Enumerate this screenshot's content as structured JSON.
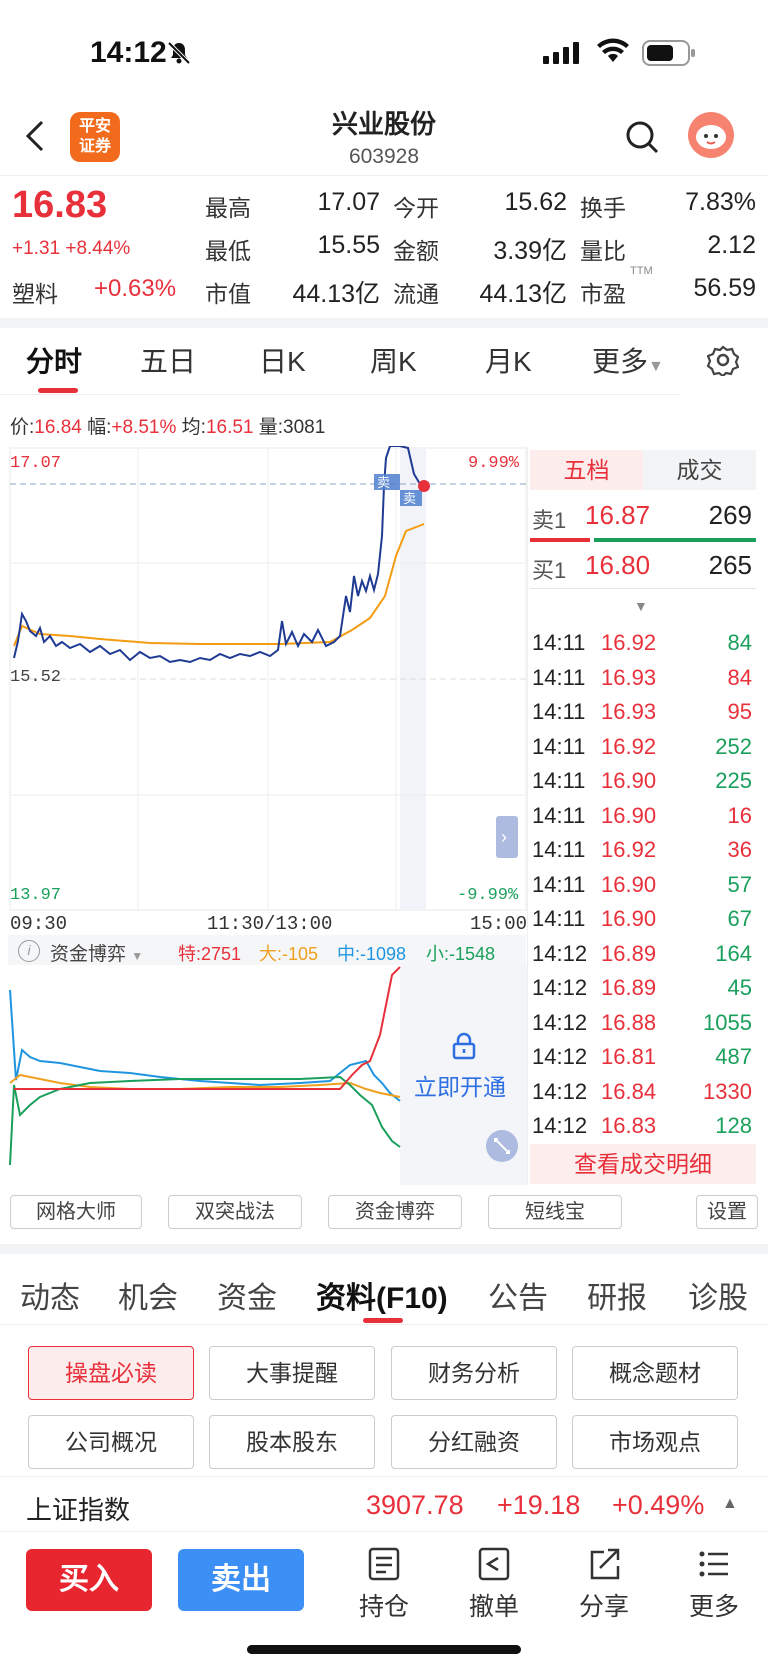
{
  "status": {
    "time": "14:12"
  },
  "header": {
    "brand": "平安\n证券",
    "name": "兴业股份",
    "code": "603928"
  },
  "quote": {
    "price": "16.83",
    "change": "+1.31",
    "change_pct": "+8.44%",
    "sector_name": "塑料",
    "sector_pct": "+0.63%",
    "high_label": "最高",
    "high": "17.07",
    "low_label": "最低",
    "low": "15.55",
    "mcap_label": "市值",
    "mcap": "44.13亿",
    "open_label": "今开",
    "open": "15.62",
    "amount_label": "金额",
    "amount": "3.39亿",
    "float_label": "流通",
    "float": "44.13亿",
    "turnover_label": "换手",
    "turnover": "7.83%",
    "ratio_label": "量比",
    "ratio": "2.12",
    "pe_label": "市盈",
    "pe_sup": "TTM",
    "pe": "56.59"
  },
  "chart_tabs": [
    "分时",
    "五日",
    "日K",
    "周K",
    "月K",
    "更多"
  ],
  "info_line": {
    "price_l": "价:",
    "price": "16.84",
    "amp_l": "幅:",
    "amp": "+8.51%",
    "avg_l": "均:",
    "avg": "16.51",
    "vol_l": "量:",
    "vol": "3081"
  },
  "axis": {
    "top_left": "17.07",
    "mid_left": "15.52",
    "bottom_left": "13.97",
    "top_right": "9.99%",
    "bottom_right": "-9.99%",
    "t_start": "09:30",
    "t_mid": "11:30/13:00",
    "t_end": "15:00",
    "sell_tag": "卖",
    "sell_tag2": "卖"
  },
  "flow": {
    "title": "资金博弈",
    "te": "特:2751",
    "da": "大:-105",
    "zhong": "中:-1098",
    "xiao": "小:-1548",
    "unlock": "立即开通"
  },
  "book": {
    "tab_five": "五档",
    "tab_deal": "成交",
    "sell1_l": "卖1",
    "sell1_p": "16.87",
    "sell1_v": "269",
    "buy1_l": "买1",
    "buy1_p": "16.80",
    "buy1_v": "265",
    "trades": [
      {
        "t": "14:11",
        "p": "16.92",
        "v": "84",
        "c": "green"
      },
      {
        "t": "14:11",
        "p": "16.93",
        "v": "84",
        "c": "red"
      },
      {
        "t": "14:11",
        "p": "16.93",
        "v": "95",
        "c": "red"
      },
      {
        "t": "14:11",
        "p": "16.92",
        "v": "252",
        "c": "green"
      },
      {
        "t": "14:11",
        "p": "16.90",
        "v": "225",
        "c": "green"
      },
      {
        "t": "14:11",
        "p": "16.90",
        "v": "16",
        "c": "red"
      },
      {
        "t": "14:11",
        "p": "16.92",
        "v": "36",
        "c": "red"
      },
      {
        "t": "14:11",
        "p": "16.90",
        "v": "57",
        "c": "green"
      },
      {
        "t": "14:11",
        "p": "16.90",
        "v": "67",
        "c": "green"
      },
      {
        "t": "14:12",
        "p": "16.89",
        "v": "164",
        "c": "green"
      },
      {
        "t": "14:12",
        "p": "16.89",
        "v": "45",
        "c": "green"
      },
      {
        "t": "14:12",
        "p": "16.88",
        "v": "1055",
        "c": "green"
      },
      {
        "t": "14:12",
        "p": "16.81",
        "v": "487",
        "c": "green"
      },
      {
        "t": "14:12",
        "p": "16.84",
        "v": "1330",
        "c": "red"
      },
      {
        "t": "14:12",
        "p": "16.83",
        "v": "128",
        "c": "green"
      }
    ],
    "detail": "查看成交明细"
  },
  "tools": [
    "网格大师",
    "双突战法",
    "资金博弈",
    "短线宝",
    "设置"
  ],
  "bottom_tabs": [
    "动态",
    "机会",
    "资金",
    "资料(F10)",
    "公告",
    "研报",
    "诊股"
  ],
  "f10": [
    "操盘必读",
    "大事提醒",
    "财务分析",
    "概念题材",
    "公司概况",
    "股本股东",
    "分红融资",
    "市场观点"
  ],
  "index": {
    "name": "上证指数",
    "value": "3907.78",
    "change": "+19.18",
    "pct": "+0.49%"
  },
  "nav": {
    "buy": "买入",
    "sell": "卖出",
    "hold": "持仓",
    "cancel": "撤单",
    "share": "分享",
    "more": "更多"
  },
  "colors": {
    "up": "#e8303b",
    "down": "#1aa05c",
    "price_line": "#1f3a93",
    "avg_line": "#f39c12"
  }
}
